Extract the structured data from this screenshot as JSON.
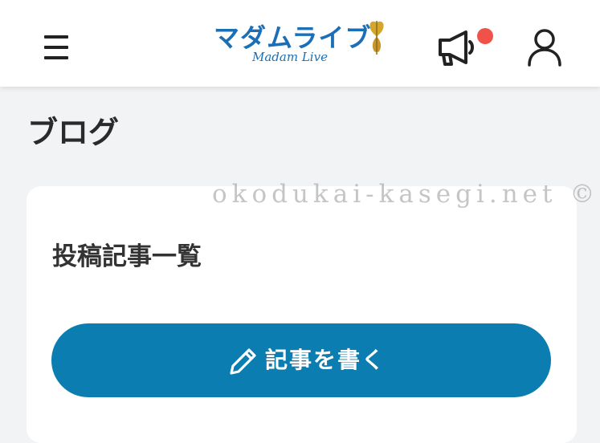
{
  "header": {
    "logo_main": "マダムライブ",
    "logo_sub": "Madam Live",
    "menu_icon": "hamburger-menu-icon",
    "notice_icon": "megaphone-icon",
    "notice_badge_color": "#f0524a",
    "user_icon": "user-icon",
    "brand_color": "#1a6fb6"
  },
  "page": {
    "title": "ブログ"
  },
  "card": {
    "title": "投稿記事一覧",
    "write_button_label": "記事を書く",
    "write_button_icon": "pencil-icon",
    "button_color": "#0b7db1"
  },
  "watermark": "okodukai-kasegi.net ©"
}
